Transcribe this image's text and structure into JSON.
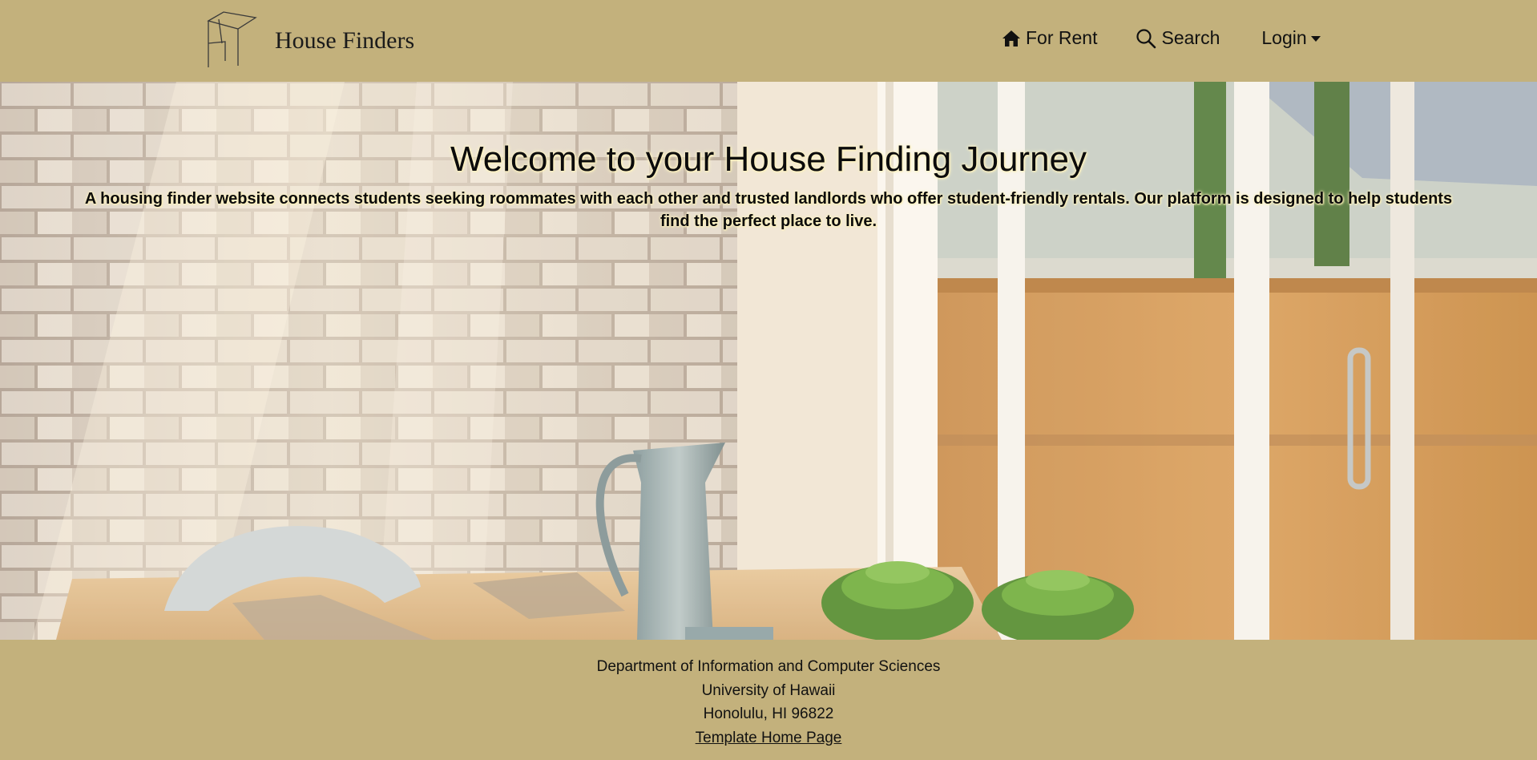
{
  "navbar": {
    "brand_name": "House Finders",
    "logo_icon": "house-outline-logo",
    "items": [
      {
        "label": "For Rent",
        "icon": "home-icon"
      },
      {
        "label": "Search",
        "icon": "search-icon"
      },
      {
        "label": "Login",
        "icon": "caret-down-icon"
      }
    ]
  },
  "hero": {
    "title": "Welcome to your House Finding Journey",
    "text": "A housing finder website connects students seeking roommates with each other and trusted landlords who offer student-friendly rentals. Our platform is designed to help students find the perfect place to live.",
    "image": "dining-room-photo"
  },
  "footer": {
    "line1": "Department of Information and Computer Sciences",
    "line2": "University of Hawaii",
    "line3": "Honolulu, HI 96822",
    "link": "Template Home Page"
  },
  "colors": {
    "background": "#c3b17c",
    "text": "#111111"
  }
}
